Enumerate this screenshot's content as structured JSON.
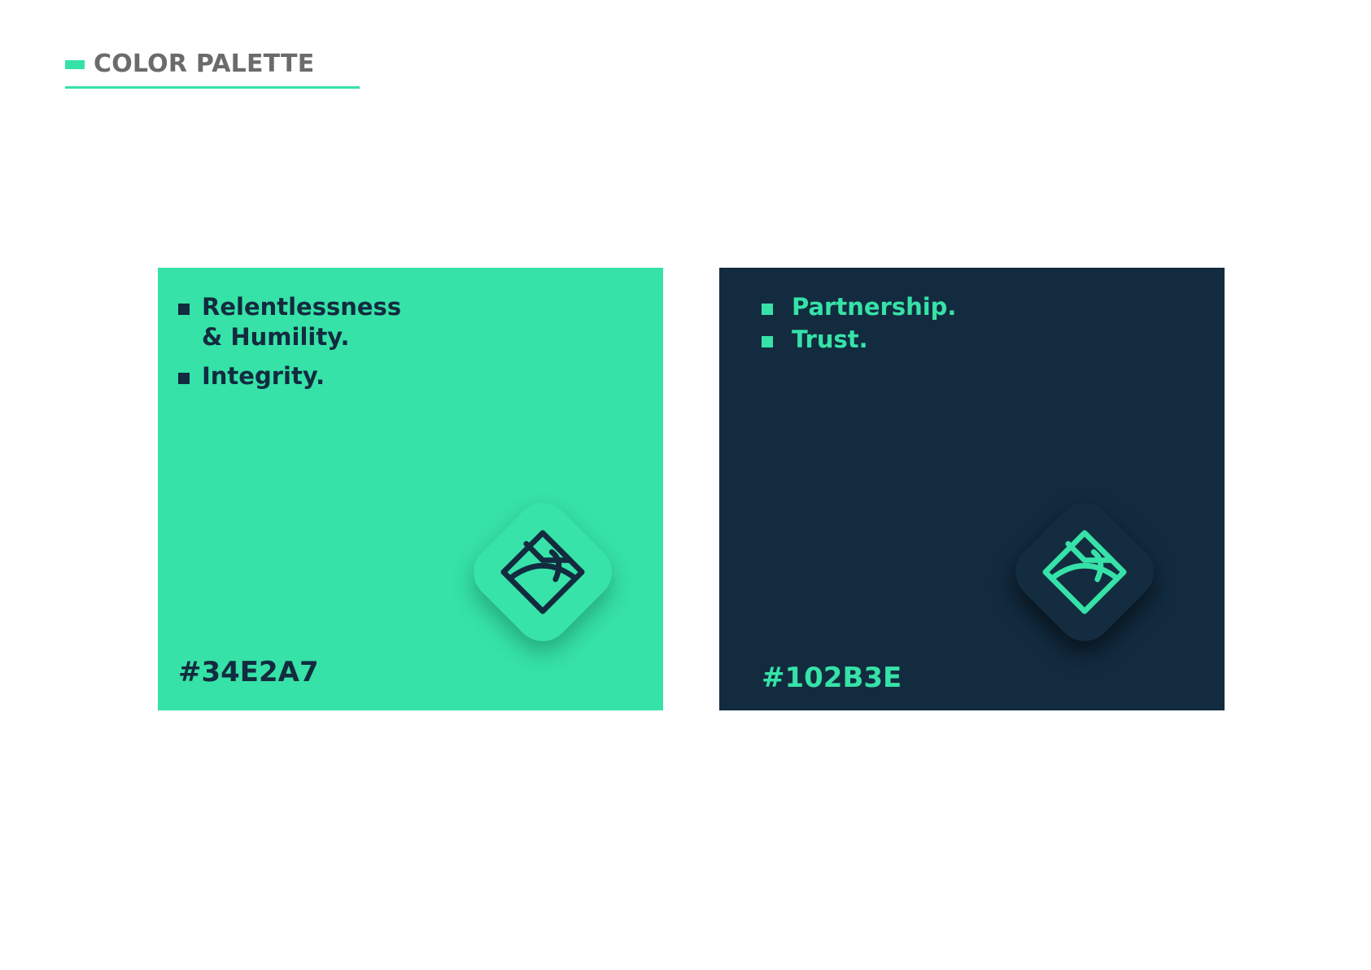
{
  "header": {
    "title": "COLOR PALETTE",
    "accent_color": "#34E2A7"
  },
  "swatches": [
    {
      "hex_label": "#34E2A7",
      "background_color": "#34E2A7",
      "text_color": "#102B3E",
      "values": [
        "Relentlessness\n& Humility.",
        "Integrity."
      ],
      "icon": "brand-logo-icon"
    },
    {
      "hex_label": "#102B3E",
      "background_color": "#102B3E",
      "text_color": "#34E2A7",
      "values": [
        "Partnership.",
        "Trust."
      ],
      "icon": "brand-logo-icon"
    }
  ]
}
